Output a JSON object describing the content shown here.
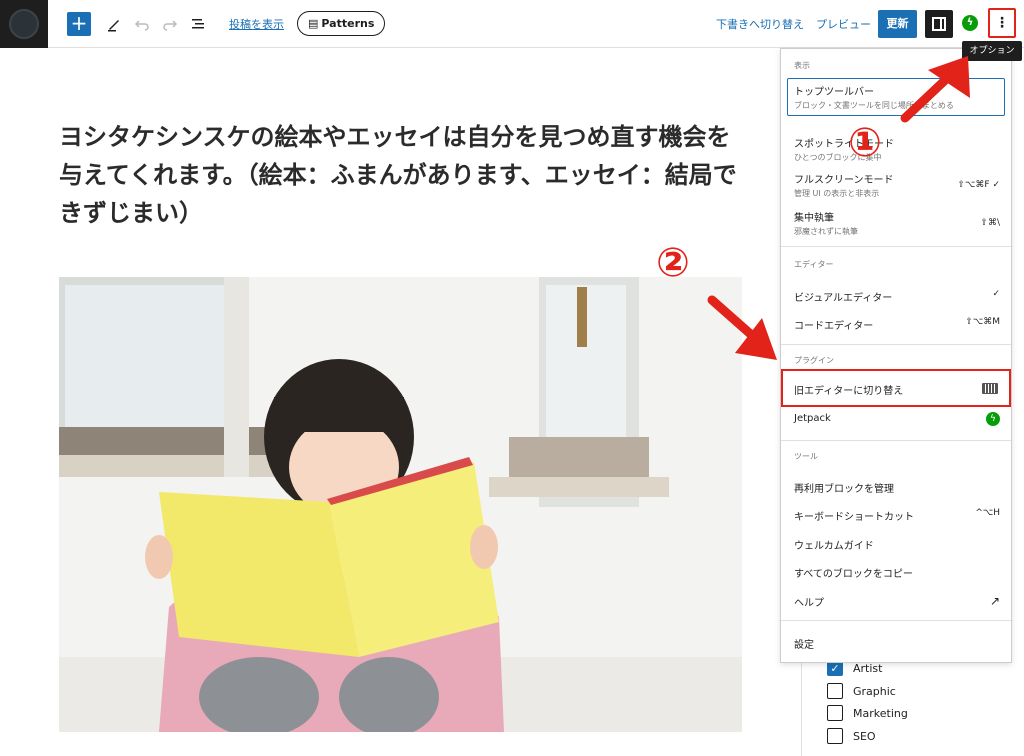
{
  "toolbar": {
    "view_posts_label": "投稿を表示",
    "patterns_label": "Patterns",
    "switch_to_draft_label": "下書きへ切り替え",
    "preview_label": "プレビュー",
    "update_label": "更新",
    "options_tooltip": "オプション",
    "options_glyph": "⋮",
    "add_glyph": "+"
  },
  "post": {
    "title": "ヨシタケシンスケの絵本やエッセイは自分を見つめ直す機会を与えてくれます。（絵本：ふまんがあります、エッセイ：結局できずじまい）"
  },
  "menu": {
    "sections": {
      "view": "表示",
      "editor": "エディター",
      "plugins": "プラグイン",
      "tools": "ツール"
    },
    "view_items": [
      {
        "label": "トップツールバー",
        "sub": "ブロック・文書ツールを同じ場所にまとめる",
        "shortcut": ""
      },
      {
        "label": "スポットライトモード",
        "sub": "ひとつのブロックに集中",
        "shortcut": ""
      },
      {
        "label": "フルスクリーンモード",
        "sub": "管理 UI の表示と非表示",
        "shortcut": "⇧⌥⌘F  ✓"
      },
      {
        "label": "集中執筆",
        "sub": "邪魔されずに執筆",
        "shortcut": "⇧⌘\\"
      }
    ],
    "editor_items": [
      {
        "label": "ビジュアルエディター",
        "shortcut": "✓"
      },
      {
        "label": "コードエディター",
        "shortcut": "⇧⌥⌘M"
      }
    ],
    "plugin_items": [
      {
        "label": "旧エディターに切り替え"
      },
      {
        "label": "Jetpack"
      }
    ],
    "tool_items": [
      {
        "label": "再利用ブロックを管理",
        "shortcut": ""
      },
      {
        "label": "キーボードショートカット",
        "shortcut": "^⌥H"
      },
      {
        "label": "ウェルカムガイド",
        "shortcut": ""
      },
      {
        "label": "すべてのブロックをコピー",
        "shortcut": ""
      },
      {
        "label": "ヘルプ",
        "shortcut": "↗"
      }
    ],
    "preferences_label": "設定"
  },
  "sidebar": {
    "categories": [
      {
        "label": "Artist",
        "checked": true
      },
      {
        "label": "Graphic",
        "checked": false
      },
      {
        "label": "Marketing",
        "checked": false
      },
      {
        "label": "SEO",
        "checked": false
      }
    ]
  },
  "annotations": {
    "step1": "①",
    "step2": "②"
  },
  "colors": {
    "accent": "#1a6fb5",
    "annotation_red": "#e2231a",
    "jetpack_green": "#069e08",
    "book_yellow": "#f2e96a"
  }
}
